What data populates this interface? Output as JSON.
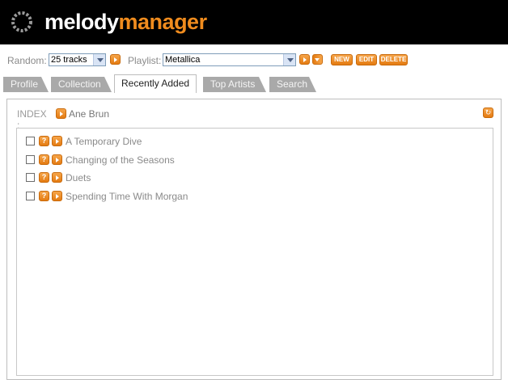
{
  "app": {
    "brand_part1": "melody",
    "brand_part2": "manager"
  },
  "toolbar": {
    "random_label": "Random:",
    "random_value": "25 tracks",
    "playlist_label": "Playlist:",
    "playlist_value": "Metallica",
    "new_label": "NEW",
    "edit_label": "EDIT",
    "delete_label": "DELETE"
  },
  "tabs": [
    {
      "label": "Profile",
      "active": false
    },
    {
      "label": "Collection",
      "active": false
    },
    {
      "label": "Recently Added",
      "active": true
    },
    {
      "label": "Top Artists",
      "active": false
    },
    {
      "label": "Search",
      "active": false
    }
  ],
  "index": {
    "label": "INDEX :",
    "artist": "Ane Brun"
  },
  "tracks": [
    {
      "title": "A Temporary Dive"
    },
    {
      "title": "Changing of the Seasons"
    },
    {
      "title": "Duets"
    },
    {
      "title": "Spending Time With Morgan"
    }
  ],
  "icons": {
    "info": "?",
    "play": "play-icon",
    "refresh": "refresh-icon"
  },
  "colors": {
    "accent": "#f08c1e",
    "header_bg": "#000000",
    "tab_inactive": "#a9a9a9"
  }
}
